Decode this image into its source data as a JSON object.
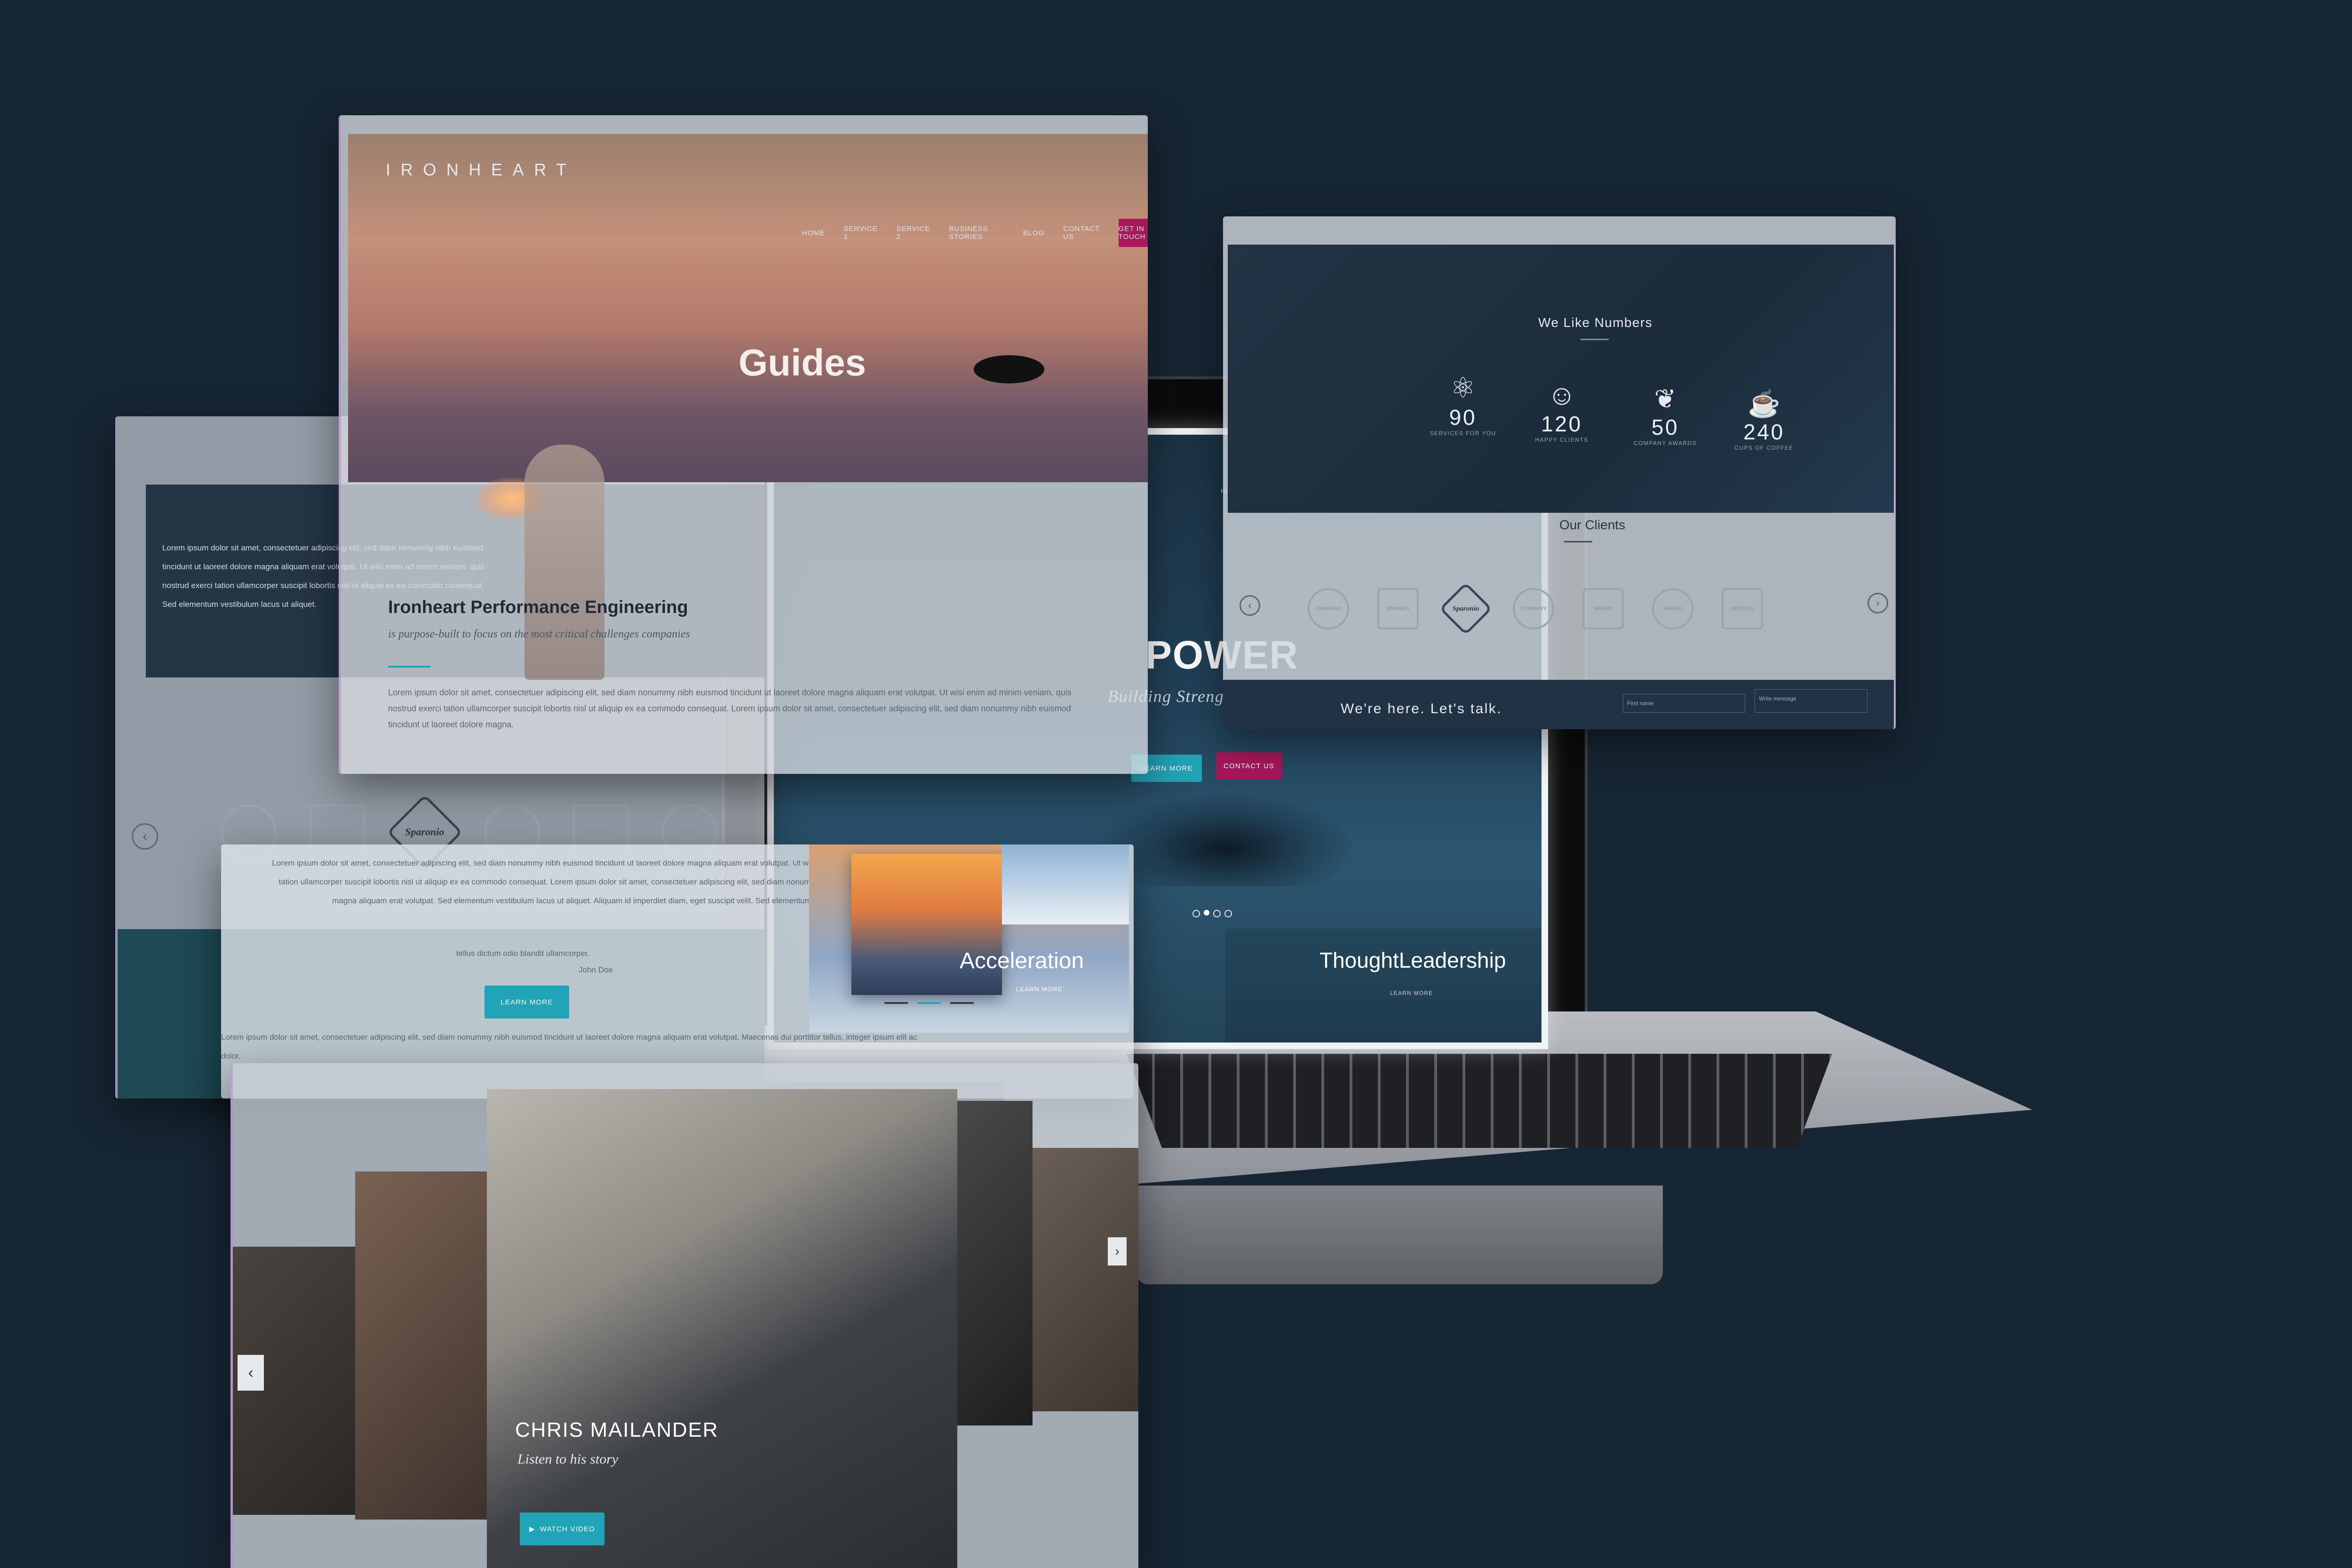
{
  "brand": "IRONHEART",
  "nav": {
    "items": [
      "HOME",
      "SERVICE 1",
      "SERVICE 2",
      "BUSINESS STORIES",
      "BLOG",
      "CONTACT US"
    ],
    "cta": "GET IN TOUCH"
  },
  "guides_panel": {
    "heading": "Guides",
    "section_title": "Ironheart Performance Engineering",
    "tagline": "is purpose-built to focus on the most critical challenges companies",
    "paragraph": "Lorem ipsum dolor sit amet, consectetuer adipiscing elit, sed diam nonummy nibh euismod tincidunt ut laoreet dolore magna aliquam erat volutpat. Ut wisi enim ad minim veniam, quis nostrud exerci tation ullamcorper suscipit lobortis nisl ut aliquip ex ea commodo consequat. Lorem ipsum dolor sit amet, consectetuer adipiscing elit, sed diam nonummy nibh euismod tincidunt ut laoreet dolore magna."
  },
  "left_panel": {
    "text": "Lorem ipsum dolor sit amet, consectetuer adipiscing elit, sed diam nonummy nibh euismod tincidunt ut laoreet dolore magna aliquam erat volutpat. Ut wisi enim ad minim veniam, quis nostrud exerci tation ullamcorper suscipit lobortis nisl ut aliquip ex ea commodo consequat. Sed elementum vestibulum lacus ut aliquet."
  },
  "testimonial_panel": {
    "text": "Lorem ipsum dolor sit amet, consectetuer adipiscing elit, sed diam nonummy nibh euismod tincidunt ut laoreet dolore magna aliquam erat volutpat. Ut wisi enim ad minim veniam, quis nostrud exerci tation ullamcorper suscipit lobortis nisl ut aliquip ex ea commodo consequat. Lorem ipsum dolor sit amet, consectetuer adipiscing elit, sed diam nonummy nibh euismod tincidunt ut laoreet dolore magna aliquam erat volutpat. Sed elementum vestibulum lacus ut aliquet. Aliquam id imperdiet diam, eget suscipit velit. Sed elementum vestibulum lacus ut aliquet.",
    "author_line": "tellus dictum odio blandit ullamcorper.",
    "author": "John Doe",
    "button": "LEARN MORE",
    "footer_text": "Lorem ipsum dolor sit amet, consectetuer adipiscing elit, sed diam nonummy nibh euismod tincidunt ut laoreet dolore magna aliquam erat volutpat. Maecenas dui porttitor tellus, integer ipsum elit ac dolor."
  },
  "hero": {
    "title": "POWER",
    "subtitle": "Building Strength from Within",
    "learn_more": "LEARN MORE",
    "contact_us": "CONTACT US",
    "thought_title": "ThoughtLeadership",
    "thought_link": "LEARN MORE",
    "acceleration_title": "Acceleration",
    "acceleration_link": "LEARN MORE"
  },
  "numbers_panel": {
    "title": "We Like Numbers",
    "stats": [
      {
        "value": "90",
        "label": "SERVICES FOR YOU",
        "icon": "atom-icon"
      },
      {
        "value": "120",
        "label": "HAPPY CLIENTS",
        "icon": "smiley-icon"
      },
      {
        "value": "50",
        "label": "COMPANY AWARDS",
        "icon": "laurel-icon"
      },
      {
        "value": "240",
        "label": "CUPS OF COFFEE",
        "icon": "coffee-cup-icon"
      }
    ],
    "clients_title": "Our Clients",
    "contact_line": "We're here.  Let's talk.",
    "first_name_placeholder": "First name",
    "message_placeholder": "Write message"
  },
  "logos": [
    "BRONKS",
    "Sparonio",
    "BRAND",
    "COMPANY"
  ],
  "people_panel": {
    "name": "CHRIS MAILANDER",
    "subtitle": "Listen to his story",
    "button": "WATCH VIDEO"
  },
  "colors": {
    "background": "#172634",
    "teal": "#21a3b8",
    "magenta": "#a8175a",
    "navy": "#223445"
  }
}
